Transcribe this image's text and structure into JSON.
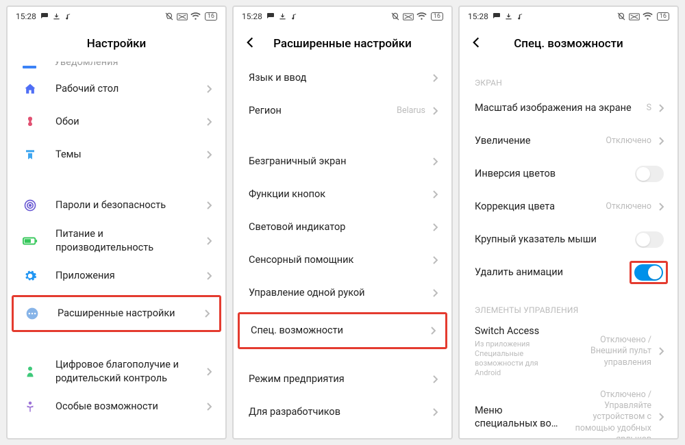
{
  "status": {
    "time": "15:28",
    "battery": "16"
  },
  "screen1": {
    "title": "Настройки",
    "partial_top": "Уведомления",
    "items": [
      {
        "label": "Рабочий стол"
      },
      {
        "label": "Обои"
      },
      {
        "label": "Темы"
      }
    ],
    "group2": [
      {
        "label": "Пароли и безопасность"
      },
      {
        "label": "Питание и производительность"
      },
      {
        "label": "Приложения"
      }
    ],
    "highlighted": {
      "label": "Расширенные настройки"
    },
    "group3": [
      {
        "label": "Цифровое благополучие и родительский контроль"
      },
      {
        "label": "Особые возможности"
      }
    ]
  },
  "screen2": {
    "title": "Расширенные настройки",
    "items": [
      {
        "label": "Язык и ввод",
        "value": ""
      },
      {
        "label": "Регион",
        "value": "Belarus"
      }
    ],
    "group2": [
      {
        "label": "Безграничный экран"
      },
      {
        "label": "Функции кнопок"
      },
      {
        "label": "Световой индикатор"
      },
      {
        "label": "Сенсорный помощник"
      },
      {
        "label": "Управление одной рукой"
      }
    ],
    "highlighted": {
      "label": "Спец. возможности"
    },
    "group3": [
      {
        "label": "Режим предприятия"
      },
      {
        "label": "Для разработчиков"
      }
    ]
  },
  "screen3": {
    "title": "Спец. возможности",
    "section1": "ЭКРАН",
    "items1": [
      {
        "label": "Масштаб изображения на экране",
        "value": "S",
        "type": "nav"
      },
      {
        "label": "Увеличение",
        "value": "Отключено",
        "type": "nav"
      },
      {
        "label": "Инверсия цветов",
        "type": "toggle",
        "on": false
      },
      {
        "label": "Коррекция цвета",
        "value": "Отключено",
        "type": "nav"
      },
      {
        "label": "Крупный указатель мыши",
        "type": "toggle",
        "on": false
      }
    ],
    "highlighted": {
      "label": "Удалить анимации",
      "type": "toggle",
      "on": true
    },
    "section2": "ЭЛЕМЕНТЫ УПРАВЛЕНИЯ",
    "items2": [
      {
        "label": "Switch Access",
        "sub": "Из приложения Специальные возможности для Android",
        "value": "Отключено / Внешний пульт управления",
        "type": "nav"
      },
      {
        "label": "Меню специальных во…",
        "value": "Отключено / Управляйте устройством с помощью удобных ярлыков",
        "type": "nav"
      }
    ]
  }
}
